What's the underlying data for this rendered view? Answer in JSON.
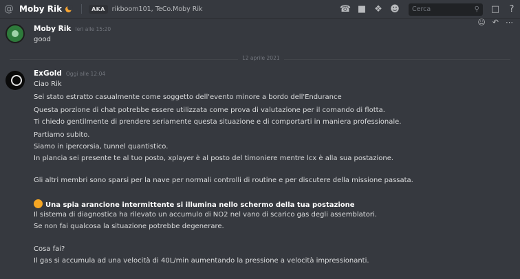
{
  "header": {
    "channel_name": "Moby Rik",
    "aka_label": "AKA",
    "aka_names": "rikboom101, TeCo.Moby Rik",
    "search_placeholder": "Cerca"
  },
  "messages": [
    {
      "author": "Moby Rik",
      "timestamp": "Ieri alle 15:20",
      "lines": [
        "good"
      ]
    },
    {
      "author": "ExGold",
      "timestamp": "Oggi alle 12:04",
      "lines": [
        "Ciao Rik",
        "Sei stato estratto casualmente come soggetto dell'evento minore a bordo dell'Endurance",
        "Questa porzione di chat potrebbe essere utilizzata come prova di valutazione per il comando di flotta.",
        "Ti chiedo gentilmente di prendere seriamente questa situazione e di comportarti in maniera professionale.",
        "Partiamo subito.",
        "Siamo in ipercorsia, tunnel quantistico.",
        "In plancia sei presente te al tuo posto, xplayer è al posto del timoniere mentre lcx è alla sua postazione.",
        "Gli altri membri sono sparsi per la nave per normali controlli di routine e per discutere della missione passata.",
        "Una spia arancione intermittente si illumina nello schermo della tua postazione",
        "Il sistema di diagnostica ha rilevato un accumulo di NO2 nel vano di scarico gas degli assemblatori.",
        "Se non fai qualcosa la situazione potrebbe degenerare.",
        "Cosa fai?",
        "Il gas si accumula ad una velocità di 40L/min aumentando la pressione a velocità impressionanti."
      ]
    }
  ],
  "date_divider": "12 aprile 2021"
}
